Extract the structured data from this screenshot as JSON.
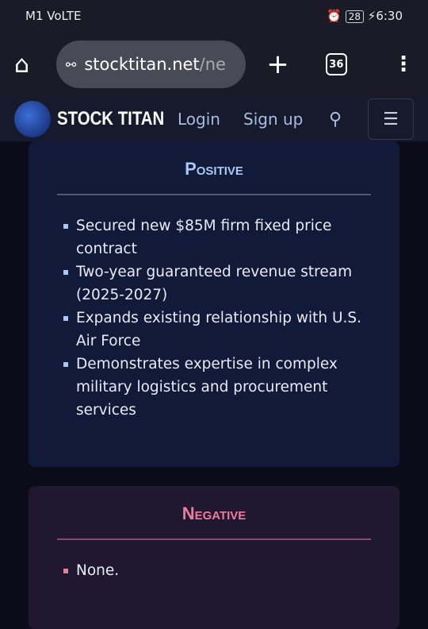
{
  "status": {
    "carrier": "M1 VoLTE",
    "battery": "28",
    "time": "6:30"
  },
  "browser": {
    "url_main": "stocktitan.net",
    "url_rest": "/ne",
    "tab_count": "36"
  },
  "site": {
    "brand": "STOCK TITAN",
    "login": "Login",
    "signup": "Sign up"
  },
  "positive": {
    "title": "Positive",
    "items": [
      "Secured new $85M firm fixed price contract",
      "Two-year guaranteed revenue stream (2025-2027)",
      "Expands existing relationship with U.S. Air Force",
      "Demonstrates expertise in complex military logistics and procurement services"
    ]
  },
  "negative": {
    "title": "Negative",
    "items": [
      "None."
    ]
  }
}
